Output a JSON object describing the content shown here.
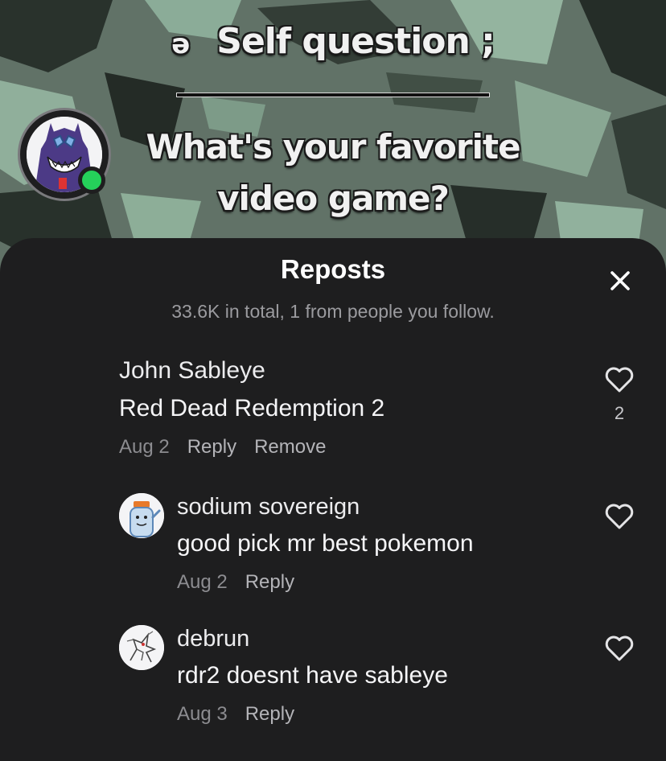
{
  "video_overlay": {
    "symbol": "ə",
    "title": "Self question ;",
    "question_line1": "What's your favorite",
    "question_line2": "video game?"
  },
  "sheet": {
    "title": "Reposts",
    "close_icon": "close-icon",
    "subtitle": "33.6K in total, 1 from people you follow."
  },
  "comments": [
    {
      "author": "John Sableye",
      "text": "Red Dead Redemption 2",
      "date": "Aug 2",
      "reply_label": "Reply",
      "remove_label": "Remove",
      "likes": "2",
      "avatar_icon": "sableye-avatar",
      "online_status_color": "#25d05a"
    },
    {
      "author": "sodium sovereign",
      "text": "good pick mr best pokemon",
      "date": "Aug 2",
      "reply_label": "Reply",
      "avatar_icon": "salt-shaker-avatar"
    },
    {
      "author": "debrun",
      "text": "rdr2 doesnt have sableye",
      "date": "Aug 3",
      "reply_label": "Reply",
      "avatar_icon": "sketch-creature-avatar"
    }
  ],
  "colors": {
    "sheet_background": "#1e1e1f",
    "primary_text": "#ffffff",
    "secondary_text": "#9b9b9f",
    "online_dot": "#25d05a"
  }
}
